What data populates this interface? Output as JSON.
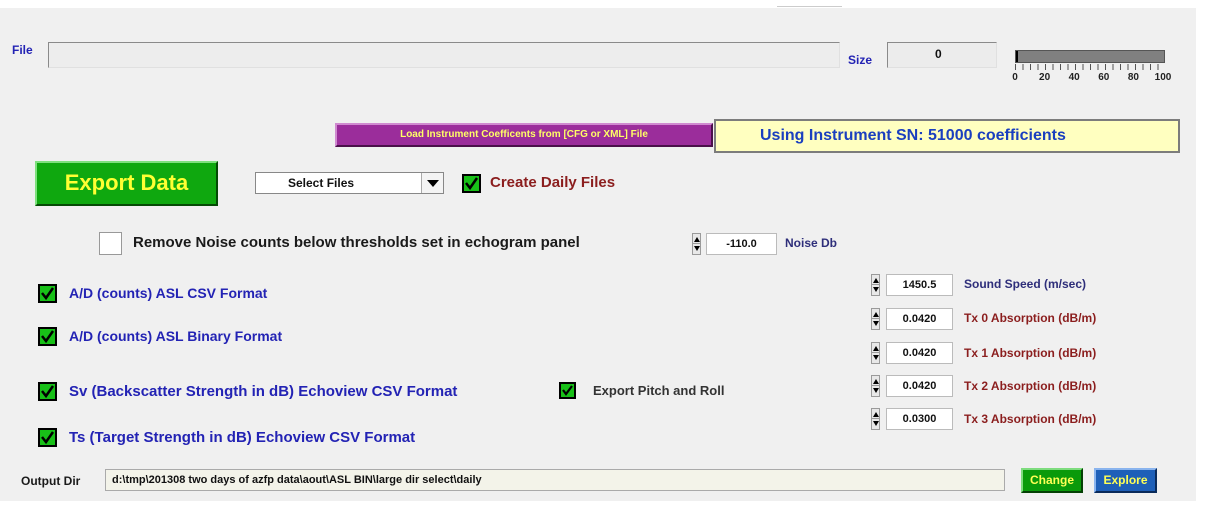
{
  "file": {
    "label": "File",
    "value": ""
  },
  "size": {
    "label": "Size",
    "value": "0"
  },
  "progress": {
    "value_percent": 0,
    "ticks": [
      "0",
      "20",
      "40",
      "60",
      "80",
      "100"
    ]
  },
  "load_coeff_button": "Load Instrument Coefficents  from [CFG or XML]  File",
  "instrument_status": "Using Instrument SN: 51000 coefficients",
  "export_button": "Export Data",
  "select_files": {
    "value": "Select Files"
  },
  "create_daily": {
    "label": "Create Daily Files",
    "checked": true
  },
  "remove_noise": {
    "label": "Remove Noise counts below thresholds set in echogram panel",
    "checked": false,
    "value": "-110.0",
    "unit": "Noise Db"
  },
  "formats": [
    {
      "label": "A/D (counts)  ASL CSV Format",
      "checked": true
    },
    {
      "label": "A/D (counts) ASL Binary Format",
      "checked": true
    },
    {
      "label": "Sv (Backscatter Strength in dB) Echoview CSV Format",
      "checked": true
    },
    {
      "label": "Ts (Target Strength in dB) Echoview CSV Format",
      "checked": true
    }
  ],
  "pitch_roll": {
    "label": "Export Pitch and Roll",
    "checked": true
  },
  "params": [
    {
      "value": "1450.5",
      "label": "Sound Speed (m/sec)"
    },
    {
      "value": "0.0420",
      "label": "Tx 0 Absorption (dB/m)"
    },
    {
      "value": "0.0420",
      "label": "Tx 1 Absorption (dB/m)"
    },
    {
      "value": "0.0420",
      "label": "Tx 2 Absorption (dB/m)"
    },
    {
      "value": "0.0300",
      "label": "Tx 3 Absorption (dB/m)"
    }
  ],
  "output_dir": {
    "label": "Output Dir",
    "value": "d:\\tmp\\201308 two days of azfp data\\aout\\ASL BIN\\large dir select\\daily"
  },
  "change_button": "Change",
  "explore_button": "Explore",
  "colors": {
    "panel": "#f0f0f0",
    "export_green": "#0fa80f",
    "export_text": "#ffff33",
    "load_purple": "#9b2d9b",
    "status_yellow": "#ffffc0",
    "status_text": "#1a3fbf",
    "change_green": "#0a9a0a",
    "explore_blue": "#1e5fb8",
    "check_green": "#18c018"
  }
}
